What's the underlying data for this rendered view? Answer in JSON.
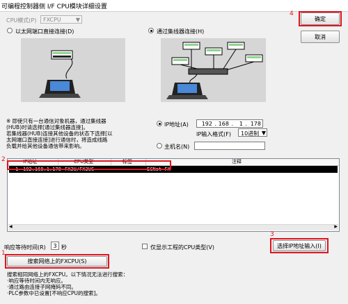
{
  "window": {
    "title": "可编程控制器侧 I/F CPU模块详细设置"
  },
  "cpu_mode": {
    "label": "CPU模式(P)",
    "value": "FXCPU"
  },
  "buttons": {
    "ok": "确定",
    "cancel": "取消",
    "search_network": "搜索网络上的FXCPU(S)",
    "select_ip": "选择IP地址输入(I)"
  },
  "connection": {
    "direct_label": "以太网端口直接连接(D)",
    "hub_label": "通过集线器连接(H)",
    "selected": "hub",
    "note": [
      "※ 即使只有一台通信对象机器，通过集线器",
      "(HUB)时请选择[通过集线器连接]。",
      "若集线器(HUB)连接其他设备的状态下选择[以",
      "太网端口直接连接]进行通信时，将造成线路",
      "负载并给其他设备通信带来影响。"
    ]
  },
  "address": {
    "ip_label": "IP地址(A)",
    "ip_octets": [
      "192",
      "168",
      "1",
      "178"
    ],
    "format_label": "IP输入格式(F)",
    "format_value": "10进制",
    "host_label": "主机名(N)",
    "host_value": ""
  },
  "table": {
    "columns": [
      "IP地址",
      "CPU类型",
      "标签",
      "注释"
    ],
    "rows": [
      {
        "no": "1",
        "ip": "192.168.1.178",
        "cpu": "FX3U/FX3UC",
        "label": "",
        "comment": "ECNet-FX"
      }
    ]
  },
  "timeout": {
    "label": "响应等待时间(R)",
    "value": "3",
    "unit": "秒"
  },
  "show_cpu_type": {
    "label": "仅显示工程的CPU类型(V)",
    "checked": false
  },
  "search_note": [
    "搜索相同网络上的FXCPU。以下情况无法进行搜索：",
    "·响应等待时间内无响应。",
    "·通过路由连接子网掩码不同。",
    "·PLC参数中已设置[不响应CPU的搜索]。"
  ],
  "annotations": [
    "1",
    "2",
    "3",
    "4"
  ],
  "colors": {
    "highlight": "#e0141e",
    "row_selected": "#000000"
  }
}
